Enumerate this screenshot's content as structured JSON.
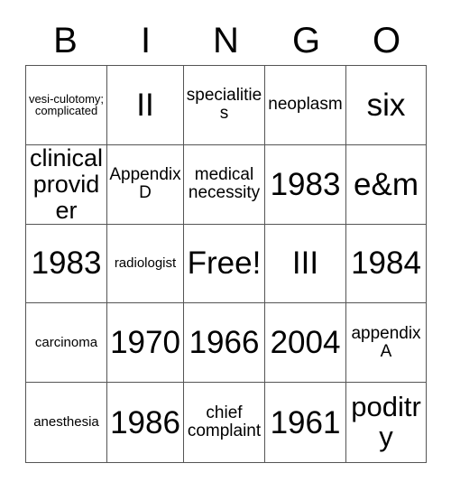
{
  "card": {
    "title": "BINGO Card",
    "headers": [
      "B",
      "I",
      "N",
      "G",
      "O"
    ],
    "free_space_label": "Free!",
    "rows": [
      [
        {
          "text": "vesi-culotomy; complicated",
          "size": "xs"
        },
        {
          "text": "II",
          "size": "xxl"
        },
        {
          "text": "specialities",
          "size": "md"
        },
        {
          "text": "neoplasm",
          "size": "md"
        },
        {
          "text": "six",
          "size": "xxl"
        }
      ],
      [
        {
          "text": "clinical provider",
          "size": "lg"
        },
        {
          "text": "Appendix D",
          "size": "md"
        },
        {
          "text": "medical necessity",
          "size": "md"
        },
        {
          "text": "1983",
          "size": "xxl"
        },
        {
          "text": "e&m",
          "size": "xxl"
        }
      ],
      [
        {
          "text": "1983",
          "size": "xxl"
        },
        {
          "text": "radiologist",
          "size": "sm"
        },
        {
          "text": "Free!",
          "size": "xxl"
        },
        {
          "text": "III",
          "size": "xxl"
        },
        {
          "text": "1984",
          "size": "xxl"
        }
      ],
      [
        {
          "text": "carcinoma",
          "size": "sm"
        },
        {
          "text": "1970",
          "size": "xxl"
        },
        {
          "text": "1966",
          "size": "xxl"
        },
        {
          "text": "2004",
          "size": "xxl"
        },
        {
          "text": "appendix A",
          "size": "md"
        }
      ],
      [
        {
          "text": "anesthesia",
          "size": "sm"
        },
        {
          "text": "1986",
          "size": "xxl"
        },
        {
          "text": "chief complaint",
          "size": "md"
        },
        {
          "text": "1961",
          "size": "xxl"
        },
        {
          "text": "poditry",
          "size": "xl"
        }
      ]
    ]
  },
  "colors": {
    "background": "#ffffff",
    "text": "#000000",
    "grid_line": "#555555"
  }
}
